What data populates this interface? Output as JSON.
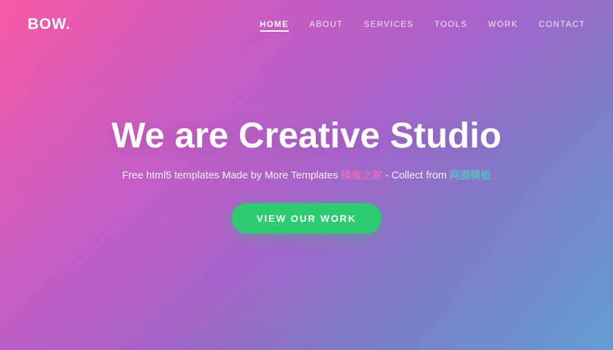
{
  "logo": {
    "text": "BOW.",
    "dot": "."
  },
  "nav": {
    "links": [
      {
        "label": "HOME",
        "active": true
      },
      {
        "label": "ABOUT",
        "active": false
      },
      {
        "label": "SERVICES",
        "active": false
      },
      {
        "label": "TOOLS",
        "active": false
      },
      {
        "label": "WORK",
        "active": false
      },
      {
        "label": "CONTACT",
        "active": false
      }
    ]
  },
  "hero": {
    "title": "We are Creative Studio",
    "subtitle_prefix": "Free html5 templates Made by More Templates ",
    "subtitle_link1": "模板之家",
    "subtitle_middle": " - Collect from ",
    "subtitle_link2": "网面模板",
    "cta_label": "VIEW OUR WORK"
  }
}
